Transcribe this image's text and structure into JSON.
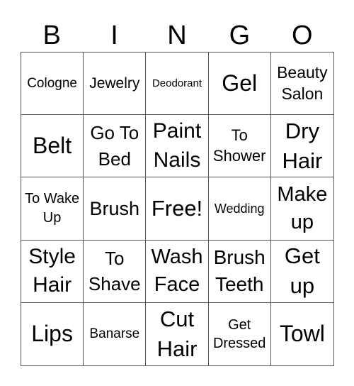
{
  "header": {
    "letters": [
      "B",
      "I",
      "N",
      "G",
      "O"
    ]
  },
  "board": {
    "cells": [
      "Cologne",
      "Jewelry",
      "Deodorant",
      "Gel",
      "Beauty Salon",
      "Belt",
      "Go To Bed",
      "Paint Nails",
      "To Shower",
      "Dry Hair",
      "To Wake Up",
      "Brush",
      "Free!",
      "Wedding",
      "Make up",
      "Style Hair",
      "To Shave",
      "Wash Face",
      "Brush Teeth",
      "Get up",
      "Lips",
      "Banarse",
      "Cut Hair",
      "Get Dressed",
      "Towl"
    ]
  }
}
